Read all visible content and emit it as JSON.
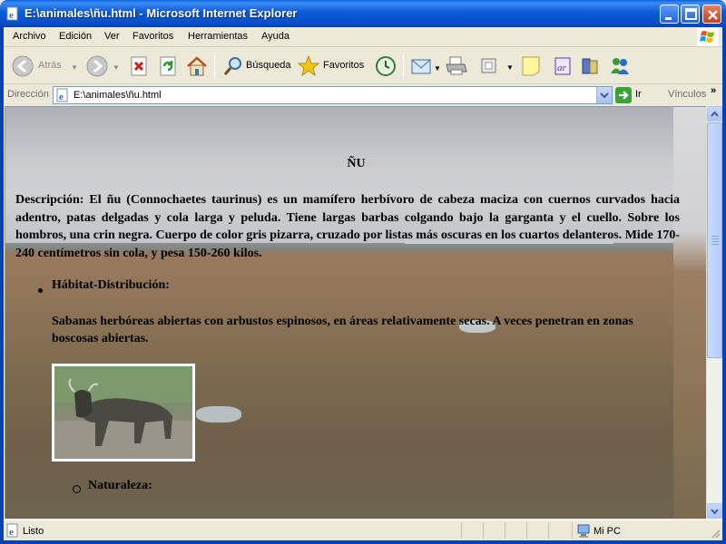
{
  "window": {
    "title": "E:\\animales\\ñu.html - Microsoft Internet Explorer"
  },
  "menu": [
    "Archivo",
    "Edición",
    "Ver",
    "Favoritos",
    "Herramientas",
    "Ayuda"
  ],
  "toolbar": {
    "back_label": "Atrás",
    "search_label": "Búsqueda",
    "favorites_label": "Favoritos"
  },
  "address": {
    "label": "Dirección",
    "value": "E:\\animales\\ñu.html",
    "go_label": "Ir",
    "links_label": "Vínculos",
    "links_chevron": "»"
  },
  "page": {
    "title": "ÑU",
    "description": "Descripción: El ñu (Connochaetes taurinus) es un mamífero herbívoro de cabeza maciza con cuernos curvados hacia adentro, patas delgadas y cola larga y peluda. Tiene largas barbas colgando bajo la garganta y el cuello. Sobre los hombros, una crin negra. Cuerpo de color gris pizarra, cruzado por listas más oscuras en los cuartos delanteros. Mide 170-240 centímetros sin cola, y pesa 150-260 kilos.",
    "habitat_heading": "Hábitat-Distribución:",
    "habitat_text": "Sabanas herbóreas abiertas con arbustos espinosos, en áreas relativamente secas. A veces penetran en zonas boscosas abiertas.",
    "nature_heading": "Naturaleza:"
  },
  "status": {
    "text": "Listo",
    "zone": "Mi PC"
  },
  "colors": {
    "titlebar": "#0a5fe0",
    "chrome": "#ece9d8"
  }
}
